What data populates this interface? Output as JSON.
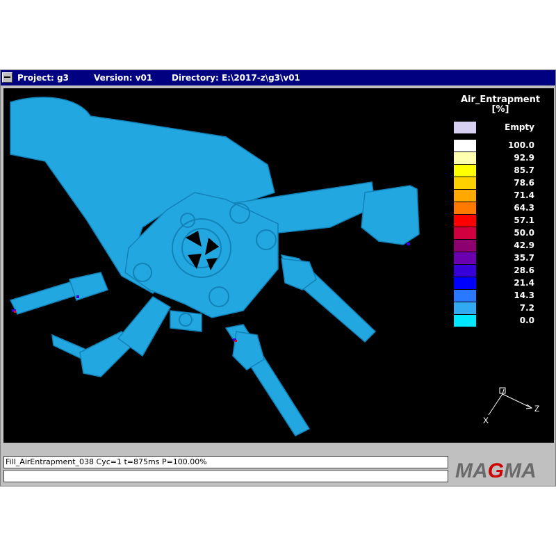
{
  "window": {
    "project_label": "Project: g3",
    "version_label": "Version: v01",
    "directory_label": "Directory: E:\\2017-z\\g3\\v01"
  },
  "legend": {
    "title_line1": "Air_Entrapment",
    "title_line2": "[%]",
    "entries": [
      {
        "label": "Empty",
        "color": "#d8d0f0"
      },
      {
        "label": "100.0",
        "color": "#ffffff"
      },
      {
        "label": "92.9",
        "color": "#ffffb0"
      },
      {
        "label": "85.7",
        "color": "#ffff00"
      },
      {
        "label": "78.6",
        "color": "#ffd000"
      },
      {
        "label": "71.4",
        "color": "#ffa800"
      },
      {
        "label": "64.3",
        "color": "#ff7800"
      },
      {
        "label": "57.1",
        "color": "#ff0000"
      },
      {
        "label": "50.0",
        "color": "#d00040"
      },
      {
        "label": "42.9",
        "color": "#8c0070"
      },
      {
        "label": "35.7",
        "color": "#6a00b0"
      },
      {
        "label": "28.6",
        "color": "#3800d8"
      },
      {
        "label": "21.4",
        "color": "#0000ff"
      },
      {
        "label": "14.3",
        "color": "#2a78ff"
      },
      {
        "label": "7.2",
        "color": "#32aaf2"
      },
      {
        "label": "0.0",
        "color": "#00e8ff"
      }
    ]
  },
  "axes": {
    "x_label": "X",
    "z_label": "Z"
  },
  "status": {
    "line1": "Fill_AirEntrapment_038 Cyc=1 t=875ms P=100.00%",
    "line2": ""
  },
  "logo": {
    "text": "MAGMA"
  },
  "colors": {
    "part": "#22a7e0",
    "part_dark": "#1282b8",
    "titlebar": "#000080",
    "viewport": "#000000"
  }
}
